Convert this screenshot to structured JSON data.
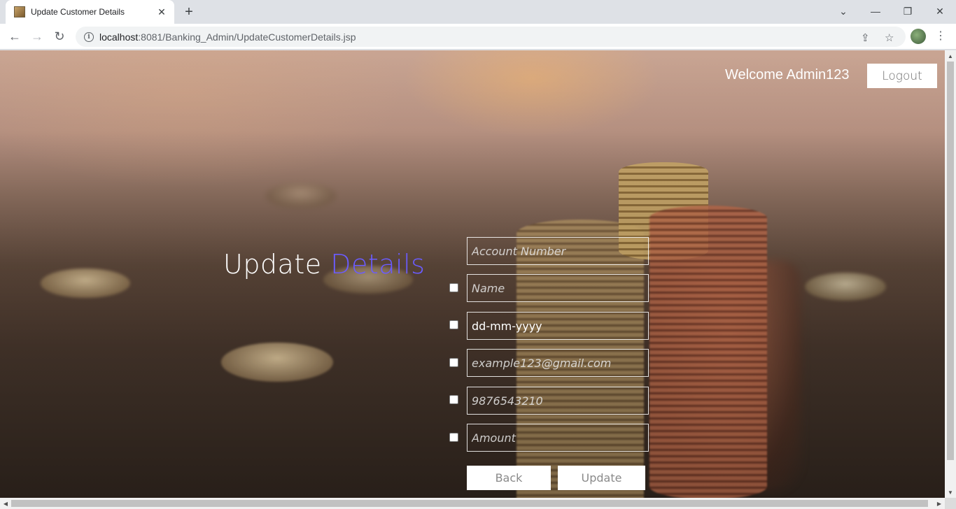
{
  "browser": {
    "tab_title": "Update Customer Details",
    "tab_close": "✕",
    "new_tab": "+",
    "url_host": "localhost",
    "url_path": ":8081/Banking_Admin/UpdateCustomerDetails.jsp",
    "win_controls": {
      "dropdown": "⌄",
      "minimize": "—",
      "restore": "❐",
      "close": "✕"
    },
    "nav": {
      "back": "←",
      "forward": "→",
      "reload": "↻"
    },
    "info_icon": "i",
    "share_icon": "⇪",
    "star_icon": "☆",
    "menu": "⋮"
  },
  "header": {
    "welcome_text": "Welcome Admin123",
    "logout_label": "Logout"
  },
  "heading": {
    "part1": "Update ",
    "part2": "Details",
    "accent_color": "#6b5cff"
  },
  "form": {
    "account_number_placeholder": "Account Number",
    "name_placeholder": "Name",
    "dob_value": "dd-mm-yyyy",
    "email_placeholder": "example123@gmail.com",
    "phone_placeholder": "9876543210",
    "amount_placeholder": "Amount",
    "back_label": "Back",
    "update_label": "Update"
  },
  "scrollbar": {
    "up": "▲",
    "down": "▼",
    "left": "◀",
    "right": "▶"
  }
}
